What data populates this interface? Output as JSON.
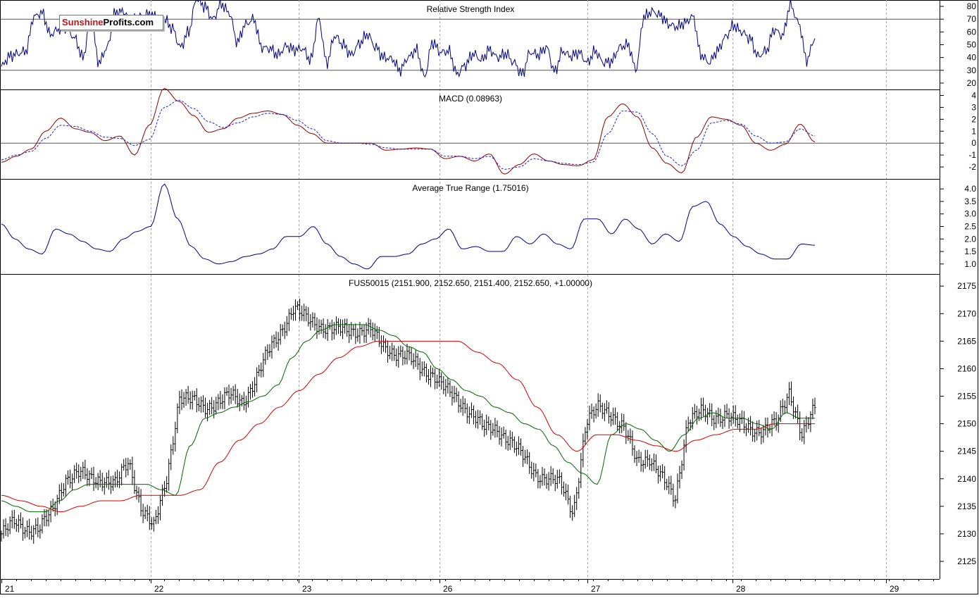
{
  "logo": {
    "part1": "Sunshine",
    "part2": "Profits.com"
  },
  "colors": {
    "rsi": "#000080",
    "macd": "#8b0000",
    "macd_signal": "#1f1fd6",
    "atr": "#000080",
    "price": "#000000",
    "ma_short": "#006400",
    "ma_long": "#d40000",
    "grid": "#a9a9a9",
    "frame": "#000000",
    "reference": "#555555"
  },
  "chart_data": [
    {
      "type": "line",
      "title": "Relative Strength Index",
      "ylim": [
        15,
        85
      ],
      "yticks": [
        20,
        30,
        40,
        50,
        60,
        70,
        80
      ],
      "reference_lines": [
        30,
        70
      ],
      "grid": true,
      "series": [
        {
          "values": [
            33,
            41,
            43,
            45,
            72,
            75,
            58,
            62,
            64,
            55,
            40,
            70,
            36,
            48,
            75,
            76,
            68,
            72,
            74,
            72,
            70,
            63,
            48,
            60,
            86,
            80,
            70,
            82,
            75,
            52,
            66,
            70,
            48,
            47,
            42,
            49,
            46,
            47,
            38,
            70,
            36,
            57,
            50,
            42,
            51,
            58,
            48,
            40,
            39,
            30,
            40,
            46,
            25,
            52,
            44,
            45,
            27,
            34,
            43,
            38,
            46,
            40,
            43,
            36,
            27,
            44,
            42,
            48,
            29,
            45,
            41,
            44,
            36,
            45,
            36,
            37,
            48,
            50,
            31,
            72,
            76,
            73,
            66,
            64,
            67,
            72,
            42,
            36,
            45,
            56,
            65,
            60,
            55,
            41,
            45,
            62,
            57,
            81,
            67,
            38,
            55
          ]
        }
      ]
    },
    {
      "type": "line",
      "title": "MACD (0.08963)",
      "ylim": [
        -3,
        4.5
      ],
      "yticks": [
        -2,
        -1,
        0,
        1,
        2,
        3,
        4
      ],
      "reference_lines": [
        0
      ],
      "grid": true,
      "series": [
        {
          "values": [
            -1.6,
            -1.1,
            -0.5,
            1.0,
            2.1,
            1.2,
            0.9,
            0.2,
            0.6,
            -1.0,
            1.5,
            4.6,
            3.5,
            2.3,
            0.9,
            1.2,
            2.1,
            2.5,
            2.7,
            2.4,
            1.5,
            0.8,
            0,
            0,
            0,
            0,
            -0.6,
            -0.5,
            -0.4,
            -0.5,
            -1.3,
            -1.1,
            -1.5,
            -0.9,
            -2.6,
            -1.8,
            -0.9,
            -1.5,
            -1.8,
            -1.9,
            -1.4,
            2.2,
            3.3,
            2.2,
            -0.4,
            -1.7,
            -2.5,
            0.5,
            2.2,
            2.0,
            1.5,
            0,
            -0.6,
            -0.1,
            1.6,
            0.1
          ]
        },
        {
          "values": [
            -1.4,
            -1.0,
            -0.7,
            0.4,
            1.5,
            1.4,
            1.0,
            0.5,
            0.4,
            -0.2,
            0.3,
            3.0,
            3.6,
            2.9,
            1.8,
            1.3,
            1.7,
            2.2,
            2.5,
            2.4,
            1.9,
            1.2,
            0.2,
            0,
            0,
            -0.1,
            -0.4,
            -0.5,
            -0.5,
            -0.5,
            -1.1,
            -1.1,
            -1.3,
            -1.1,
            -2.2,
            -2.0,
            -1.3,
            -1.5,
            -1.7,
            -1.8,
            -1.6,
            0.8,
            2.7,
            2.6,
            0.8,
            -1.1,
            -1.9,
            -0.6,
            1.7,
            1.9,
            1.6,
            0.6,
            0,
            0.1,
            1.2,
            0.6
          ]
        }
      ]
    },
    {
      "type": "line",
      "title": "Average True Range (1.75016)",
      "ylim": [
        0.6,
        4.4
      ],
      "yticks": [
        1.0,
        1.5,
        2.0,
        2.5,
        3.0,
        3.5,
        4.0
      ],
      "grid": true,
      "series": [
        {
          "values": [
            2.6,
            2.0,
            1.6,
            1.4,
            2.4,
            2.2,
            1.9,
            1.6,
            1.5,
            2.0,
            2.3,
            2.5,
            4.2,
            2.8,
            1.7,
            1.2,
            1.0,
            1.1,
            1.3,
            1.4,
            1.6,
            2.1,
            2.1,
            2.5,
            1.8,
            1.3,
            1.0,
            0.8,
            1.3,
            1.3,
            1.4,
            1.8,
            2.0,
            2.4,
            1.6,
            1.7,
            1.5,
            1.5,
            2.1,
            1.8,
            2.2,
            1.8,
            1.6,
            2.8,
            2.8,
            2.2,
            2.8,
            2.4,
            1.8,
            2.2,
            1.9,
            3.3,
            3.5,
            2.6,
            2.1,
            1.7,
            1.4,
            1.2,
            1.2,
            1.8,
            1.75
          ]
        }
      ]
    },
    {
      "type": "line",
      "title": "FUS50015 (2151.900, 2152.650, 2151.400, 2152.650, +1.00000)",
      "ylim": [
        2121.8,
        2177.2
      ],
      "yticks": [
        2125,
        2130,
        2135,
        2140,
        2145,
        2150,
        2155,
        2160,
        2165,
        2170,
        2175
      ],
      "grid": true,
      "x_labels": [
        "21",
        "22",
        "23",
        "26",
        "27",
        "28",
        "29"
      ],
      "series": [
        {
          "values": [
            2130,
            2132,
            2131,
            2131,
            2134,
            2140,
            2141,
            2140,
            2140,
            2139,
            2143,
            2135,
            2131,
            2140,
            2155,
            2154,
            2153,
            2154,
            2155,
            2154,
            2158,
            2163,
            2167,
            2171,
            2169,
            2168,
            2167,
            2167,
            2167,
            2167,
            2164,
            2163,
            2162,
            2160,
            2159,
            2156,
            2154,
            2152,
            2149,
            2149,
            2147,
            2144,
            2141,
            2140,
            2139,
            2134,
            2150,
            2153,
            2152,
            2149,
            2143,
            2144,
            2140,
            2136,
            2151,
            2152,
            2151,
            2152,
            2150,
            2149,
            2149,
            2150,
            2156,
            2148,
            2152.65
          ]
        },
        {
          "values": [
            2136,
            2135,
            2134,
            2134,
            2136,
            2138,
            2139,
            2139,
            2139,
            2139,
            2139,
            2138,
            2137,
            2146,
            2151,
            2152,
            2153,
            2154,
            2155,
            2157,
            2162,
            2165,
            2167,
            2168,
            2168,
            2168,
            2167,
            2166,
            2164,
            2163,
            2160,
            2158,
            2156,
            2155,
            2153,
            2152,
            2150,
            2149,
            2146,
            2143,
            2141,
            2139,
            2148,
            2150,
            2149,
            2147,
            2145,
            2148,
            2151,
            2152,
            2151,
            2151,
            2150,
            2149,
            2152,
            2151,
            2151
          ]
        },
        {
          "values": [
            2137,
            2136,
            2135,
            2134,
            2135,
            2136,
            2136,
            2137,
            2137,
            2137,
            2138,
            2143,
            2147,
            2150,
            2153,
            2156,
            2159,
            2162,
            2164,
            2165,
            2165,
            2165,
            2165,
            2165,
            2163,
            2161,
            2158,
            2153,
            2148,
            2145,
            2148,
            2148,
            2147,
            2146,
            2145,
            2147,
            2148,
            2149,
            2149,
            2150,
            2150,
            2150
          ]
        }
      ]
    }
  ]
}
